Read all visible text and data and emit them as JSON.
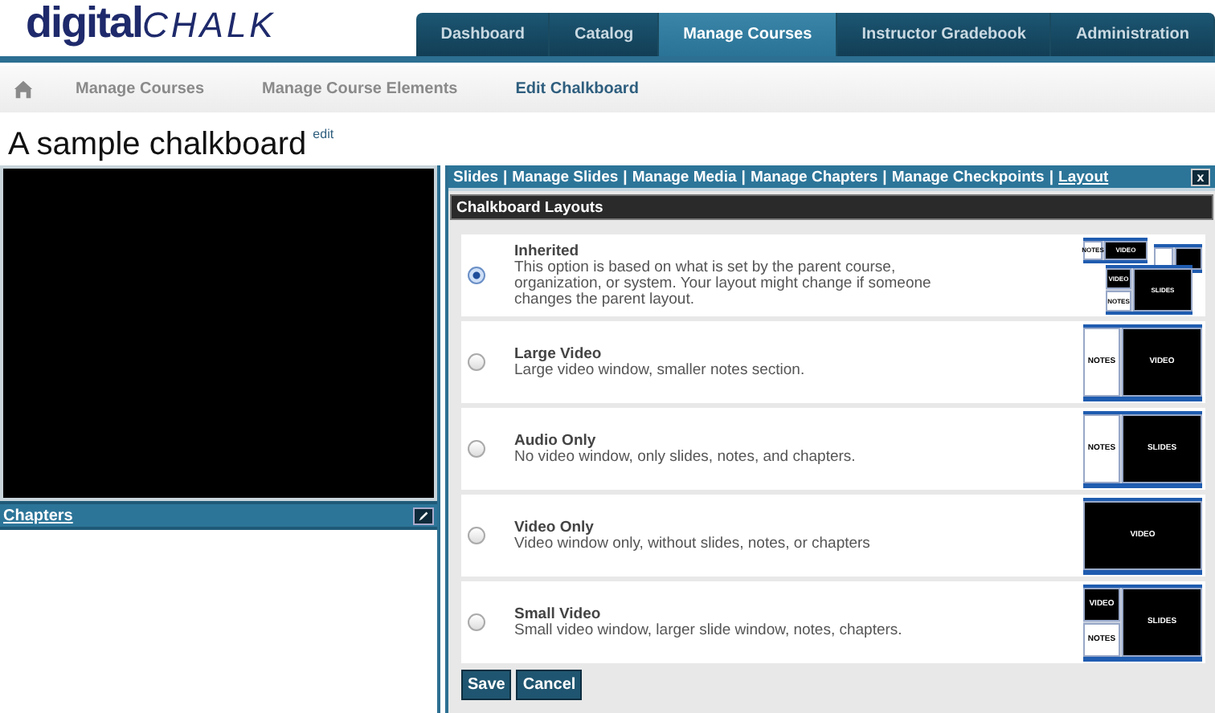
{
  "logo": {
    "main": "digital",
    "script": "CHALK"
  },
  "nav_tabs": [
    {
      "label": "Dashboard",
      "selected": false
    },
    {
      "label": "Catalog",
      "selected": false
    },
    {
      "label": "Manage Courses",
      "selected": true
    },
    {
      "label": "Instructor Gradebook",
      "selected": false
    },
    {
      "label": "Administration",
      "selected": false
    }
  ],
  "breadcrumbs": [
    {
      "label": "Manage Courses",
      "current": false
    },
    {
      "label": "Manage Course Elements",
      "current": false
    },
    {
      "label": "Edit Chalkboard",
      "current": true
    }
  ],
  "page_title": "A sample chalkboard",
  "title_edit_link": "edit",
  "chapters_panel": {
    "title": "Chapters"
  },
  "toolbar_links": [
    {
      "kind": "link",
      "label": "Slides",
      "selected": false
    },
    {
      "kind": "separator",
      "label": "|"
    },
    {
      "kind": "link",
      "label": "Manage Slides",
      "selected": false
    },
    {
      "kind": "separator",
      "label": "|"
    },
    {
      "kind": "link",
      "label": "Manage Media",
      "selected": false
    },
    {
      "kind": "separator",
      "label": "|"
    },
    {
      "kind": "link",
      "label": "Manage Chapters",
      "selected": false
    },
    {
      "kind": "separator",
      "label": "|"
    },
    {
      "kind": "link",
      "label": "Manage Checkpoints",
      "selected": false
    },
    {
      "kind": "separator",
      "label": "|"
    },
    {
      "kind": "link",
      "label": "Layout",
      "selected": true
    }
  ],
  "close_label": "x",
  "section_title": "Chalkboard Layouts",
  "layouts": [
    {
      "name": "Inherited",
      "description": "This option is based on what is set by the parent course, organization, or system. Your layout might change if someone changes the parent layout.",
      "selected": true,
      "preview": {
        "kind": "composite",
        "labels": [
          "NOTES",
          "VIDEO",
          "VIDEO",
          "NOTES",
          "SLIDES"
        ]
      }
    },
    {
      "name": "Large Video",
      "description": "Large video window, smaller notes section.",
      "selected": false,
      "preview": {
        "kind": "split",
        "labels": [
          "NOTES",
          "VIDEO"
        ]
      }
    },
    {
      "name": "Audio Only",
      "description": "No video window, only slides, notes, and chapters.",
      "selected": false,
      "preview": {
        "kind": "split",
        "labels": [
          "NOTES",
          "SLIDES"
        ]
      }
    },
    {
      "name": "Video Only",
      "description": "Video window only, without slides, notes, or chapters",
      "selected": false,
      "preview": {
        "kind": "single",
        "labels": [
          "VIDEO"
        ]
      }
    },
    {
      "name": "Small Video",
      "description": "Small video window, larger slide window, notes, chapters.",
      "selected": false,
      "preview": {
        "kind": "stacked",
        "labels": [
          "VIDEO",
          "NOTES",
          "SLIDES"
        ]
      }
    }
  ],
  "buttons": [
    "Save",
    "Cancel"
  ]
}
